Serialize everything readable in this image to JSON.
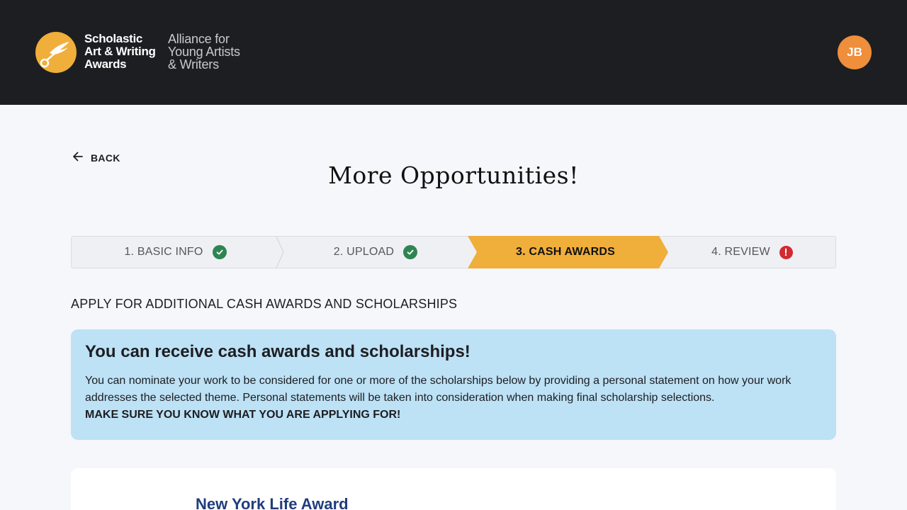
{
  "header": {
    "logo_bold_lines": [
      "Scholastic",
      "Art & Writing",
      "Awards"
    ],
    "logo_light_lines": [
      "Alliance for",
      "Young Artists",
      "& Writers"
    ],
    "avatar_initials": "JB",
    "avatar_color": "#ef8e3b"
  },
  "back": {
    "label": "BACK",
    "icon": "arrow-left-icon"
  },
  "page_title": "More Opportunities!",
  "stepper": {
    "steps": [
      {
        "label": "1. BASIC INFO",
        "status": "complete",
        "icon": "check-circle-icon"
      },
      {
        "label": "2. UPLOAD",
        "status": "complete",
        "icon": "check-circle-icon"
      },
      {
        "label": "3. CASH AWARDS",
        "status": "active",
        "icon": ""
      },
      {
        "label": "4. REVIEW",
        "status": "error",
        "icon": "alert-circle-icon"
      }
    ],
    "colors": {
      "active": "#f0ae3a",
      "complete": "#2e8551",
      "error": "#d12b30"
    }
  },
  "section_heading": "APPLY FOR ADDITIONAL CASH AWARDS AND SCHOLARSHIPS",
  "info_card": {
    "title": "You can receive cash awards and scholarships!",
    "body": "You can nominate your work to be considered for one or more of the scholarships below by providing a personal statement on how your work addresses the selected theme. Personal statements will be taken into consideration when making final scholarship selections.",
    "emphasis": "MAKE SURE YOU KNOW WHAT YOU ARE APPLYING FOR!",
    "background": "#bde1f5"
  },
  "award_card": {
    "title": "New York Life Award"
  }
}
